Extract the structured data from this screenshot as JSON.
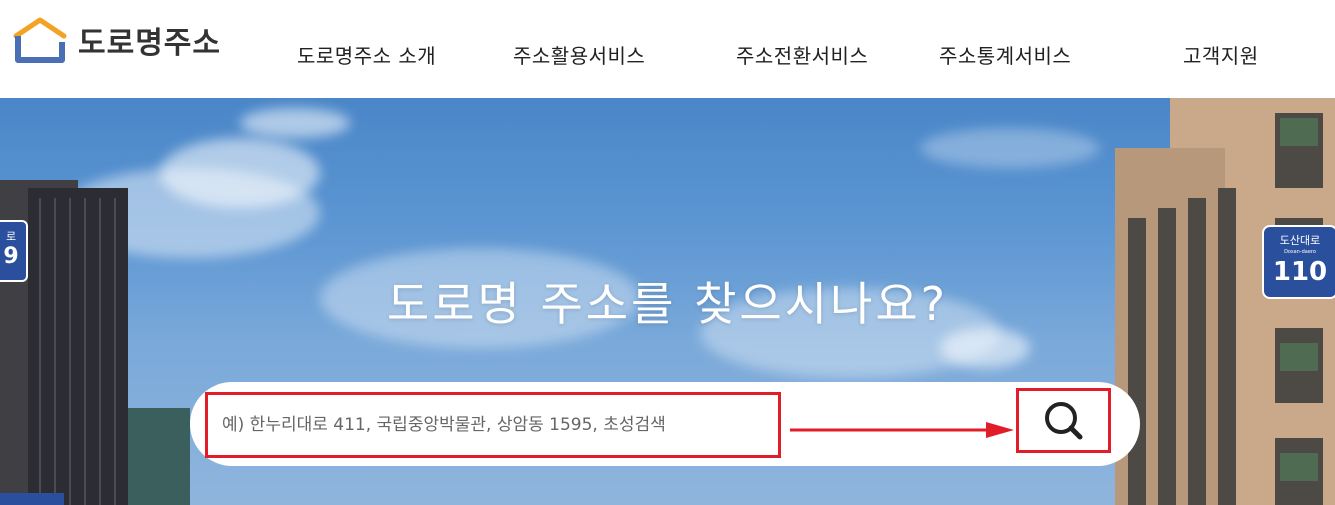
{
  "header": {
    "logo_text": "도로명주소",
    "nav": [
      {
        "label": "도로명주소 소개"
      },
      {
        "label": "주소활용서비스"
      },
      {
        "label": "주소전환서비스"
      },
      {
        "label": "주소통계서비스"
      },
      {
        "label": "고객지원"
      }
    ]
  },
  "hero": {
    "title": "도로명 주소를 찾으시나요?",
    "sign_left": {
      "line1": "로",
      "line2": "9"
    },
    "sign_right": {
      "line1": "도산대로",
      "line2": "Dosan-daero",
      "number": "110"
    }
  },
  "search": {
    "placeholder": "예) 한누리대로 411, 국립중앙박물관, 상암동 1595, 초성검색",
    "value": ""
  },
  "icons": {
    "search": "search-icon",
    "logo": "home-logo-icon",
    "arrow": "red-arrow-annotation"
  },
  "colors": {
    "annotation": "#e11d2a",
    "sign_blue": "#2a4f9c",
    "hero_sky": "#5b95d2"
  }
}
